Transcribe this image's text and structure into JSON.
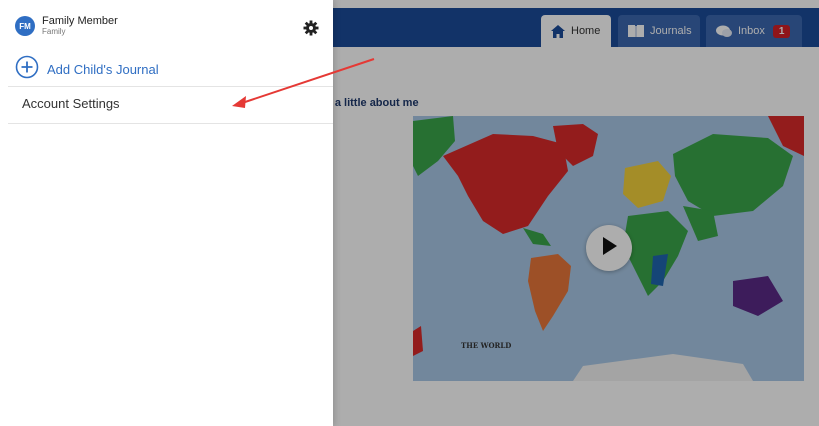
{
  "app": {
    "tabs": [
      {
        "label": "Home",
        "icon": "home-icon"
      },
      {
        "label": "Journals",
        "icon": "book-icon"
      },
      {
        "label": "Inbox",
        "icon": "chat-icon",
        "badge": "1"
      }
    ],
    "welcome_text": "lcome a little about me",
    "video": {
      "map_title": "THE WORLD",
      "play_icon": "play-icon"
    },
    "colors": {
      "topbar": "#1b4c9a",
      "badge": "#d32027",
      "accent": "#2f6ec3"
    }
  },
  "drawer": {
    "user": {
      "initials": "FM",
      "name": "Family Member",
      "role": "Family"
    },
    "settings_icon": "gear-icon",
    "add_journal_label": "Add Child's Journal",
    "menu_items": [
      {
        "label": "Account Settings"
      }
    ]
  },
  "annotation": {
    "type": "arrow",
    "color": "#e53935"
  }
}
